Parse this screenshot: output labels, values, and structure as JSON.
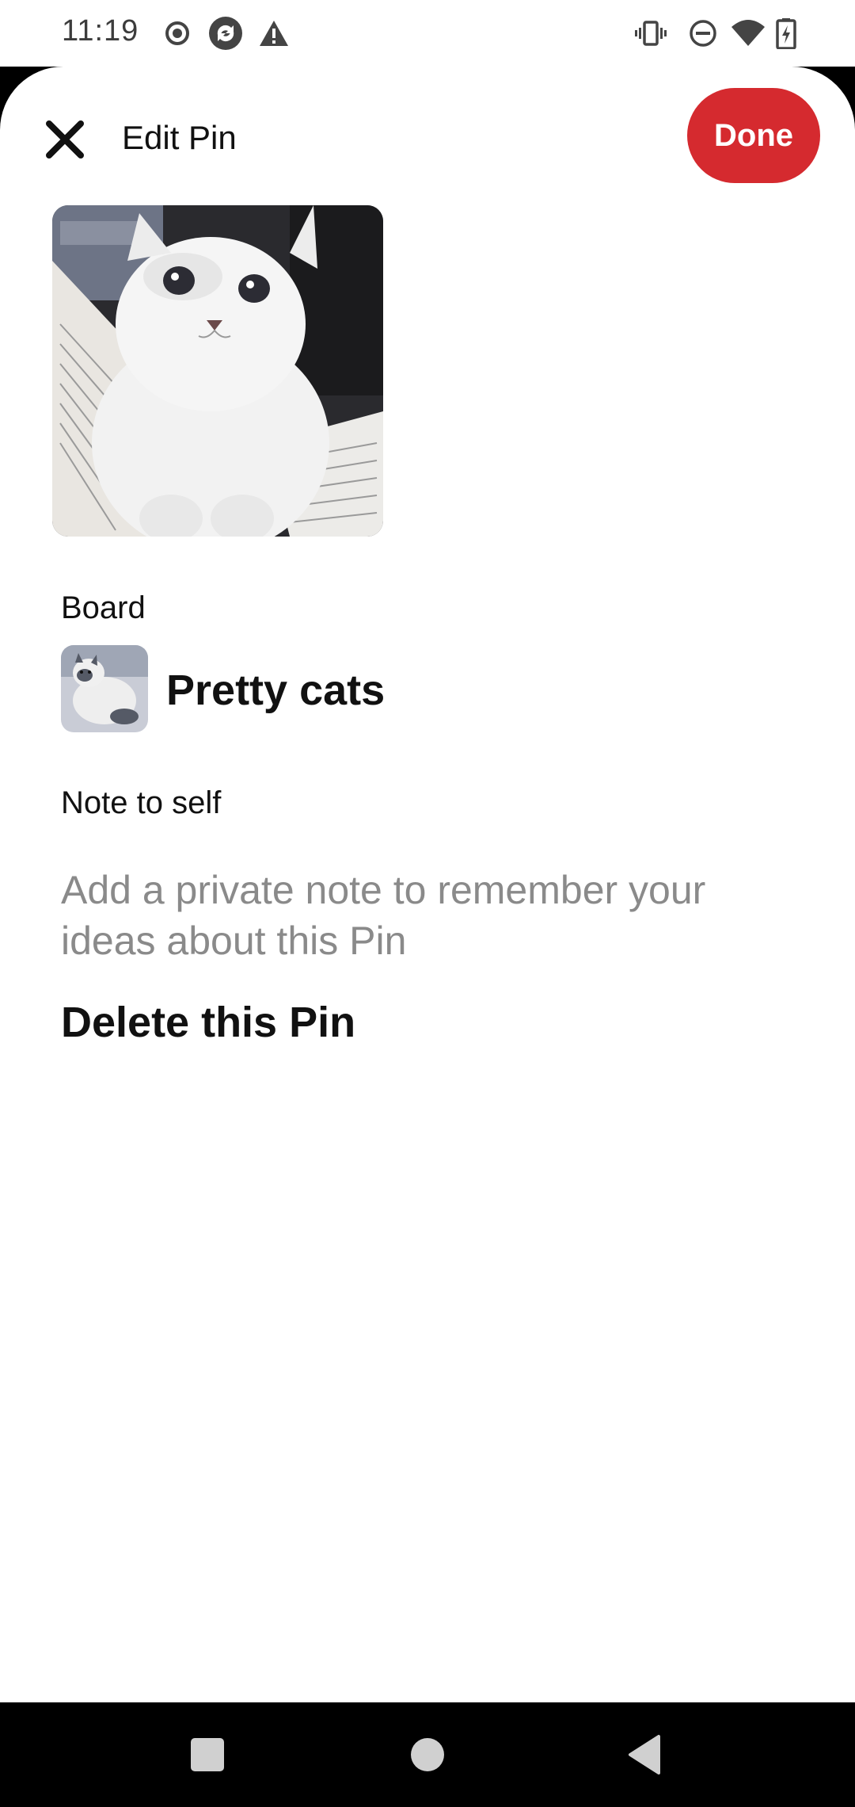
{
  "status_bar": {
    "time": "11:19",
    "icons": [
      "record-icon",
      "sync-app-icon",
      "warning-icon",
      "vibrate-icon",
      "dnd-icon",
      "wifi-icon",
      "battery-charging-icon"
    ]
  },
  "header": {
    "title": "Edit Pin",
    "done_label": "Done",
    "close_icon": "close-icon"
  },
  "pin": {
    "image": "white-fluffy-cat-on-book"
  },
  "board": {
    "label": "Board",
    "name": "Pretty cats",
    "thumbnail": "cat-thumbnail"
  },
  "note": {
    "label": "Note to self",
    "placeholder": "Add a private note to remember your ideas about this Pin"
  },
  "actions": {
    "delete_label": "Delete this Pin"
  },
  "nav_bar": {
    "icons": [
      "recents-square-icon",
      "home-circle-icon",
      "back-triangle-icon"
    ]
  },
  "colors": {
    "accent": "#d52a2f",
    "placeholder": "#8a8a8a",
    "text": "#111111"
  }
}
